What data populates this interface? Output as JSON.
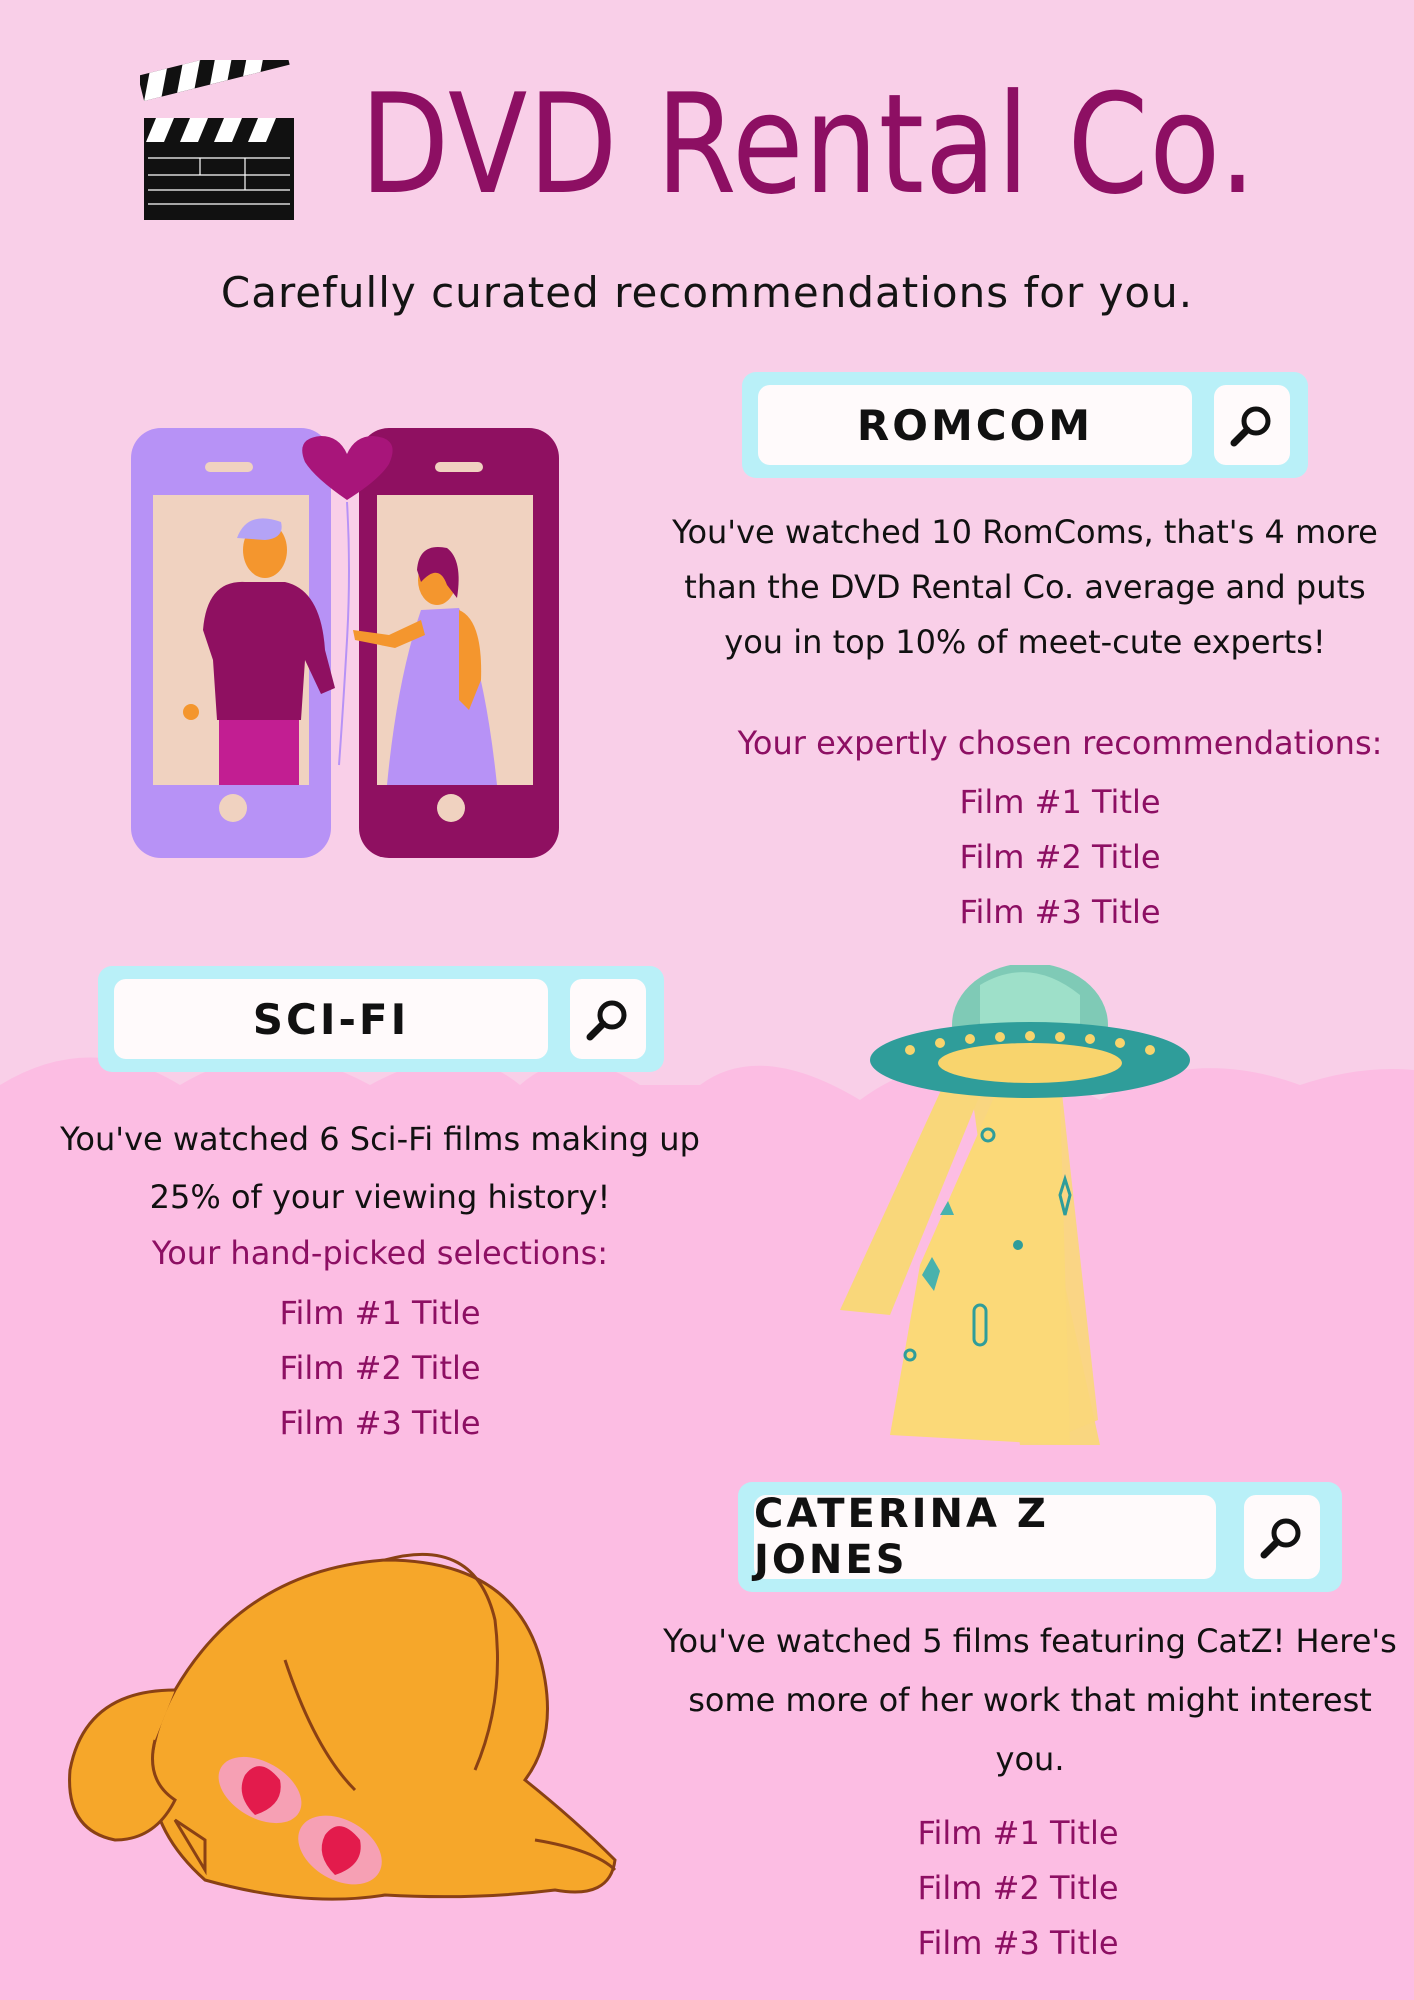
{
  "header": {
    "title": "DVD Rental Co.",
    "tagline": "Carefully curated recommendations for you."
  },
  "colors": {
    "background_top": "#f9cfe8",
    "background_bottom": "#fcbde3",
    "accent": "#8d0f63",
    "search_frame": "#b9f0f8"
  },
  "icons": [
    "clapperboard-icon",
    "search-icon",
    "phone-couple-illustration",
    "ufo-illustration",
    "cat-illustration"
  ],
  "sections": [
    {
      "search_term": "ROMCOM",
      "summary": "You've watched 10 RomComs, that's 4 more than the DVD Rental Co. average and puts you in top 10% of meet-cute experts!",
      "recommendations_heading": "Your expertly chosen recommendations:",
      "films": [
        "Film #1 Title",
        "Film #2 Title",
        "Film #3 Title"
      ]
    },
    {
      "search_term": "SCI-FI",
      "summary": "You've watched 6 Sci-Fi films making up 25% of your viewing history!",
      "recommendations_heading": "Your hand-picked selections:",
      "films": [
        "Film #1 Title",
        "Film #2 Title",
        "Film #3 Title"
      ]
    },
    {
      "search_term": "CATERINA Z JONES",
      "summary": "You've watched 5 films featuring CatZ! Here's some more of her work that might interest you.",
      "recommendations_heading": "",
      "films": [
        "Film #1 Title",
        "Film #2 Title",
        "Film #3 Title"
      ]
    }
  ]
}
